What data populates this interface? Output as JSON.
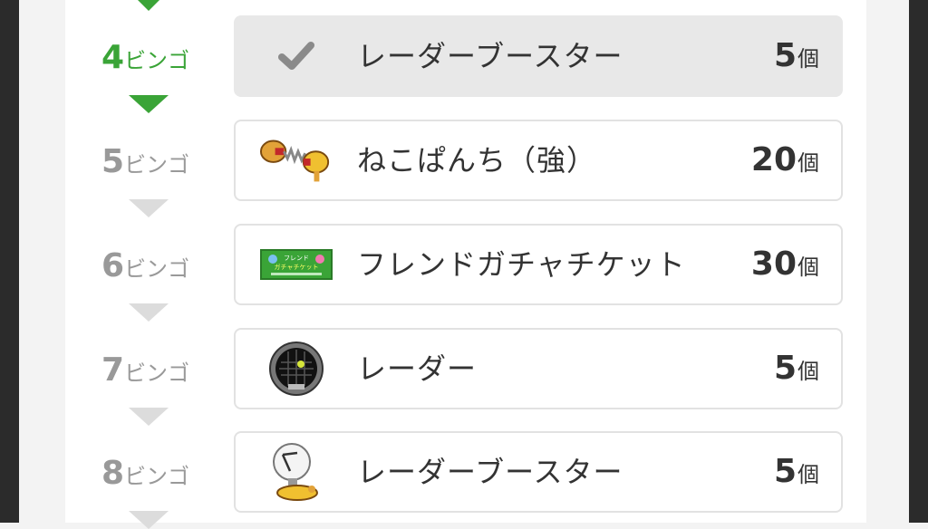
{
  "rows": [
    {
      "bingo_num": "4",
      "bingo_suffix": "ビンゴ",
      "item": "レーダーブースター",
      "count": "5",
      "unit": "個",
      "status": "completed",
      "icon": "check-icon"
    },
    {
      "bingo_num": "5",
      "bingo_suffix": "ビンゴ",
      "item": "ねこぱんち（強）",
      "count": "20",
      "unit": "個",
      "icon": "cat-punch-icon"
    },
    {
      "bingo_num": "6",
      "bingo_suffix": "ビンゴ",
      "item": "フレンドガチャチケット",
      "count": "30",
      "unit": "個",
      "icon": "friend-gacha-ticket-icon",
      "icon_text": [
        "フレンド",
        "ガチャチケット"
      ]
    },
    {
      "bingo_num": "7",
      "bingo_suffix": "ビンゴ",
      "item": "レーダー",
      "count": "5",
      "unit": "個",
      "icon": "radar-icon"
    },
    {
      "bingo_num": "8",
      "bingo_suffix": "ビンゴ",
      "item": "レーダーブースター",
      "count": "5",
      "unit": "個",
      "icon": "radar-booster-icon"
    }
  ],
  "colors": {
    "accent": "#3aa437",
    "inactive": "#999999",
    "card_border": "#e2e2e2",
    "active_card": "#e8e8e8",
    "frame": "#2b2b2b"
  }
}
